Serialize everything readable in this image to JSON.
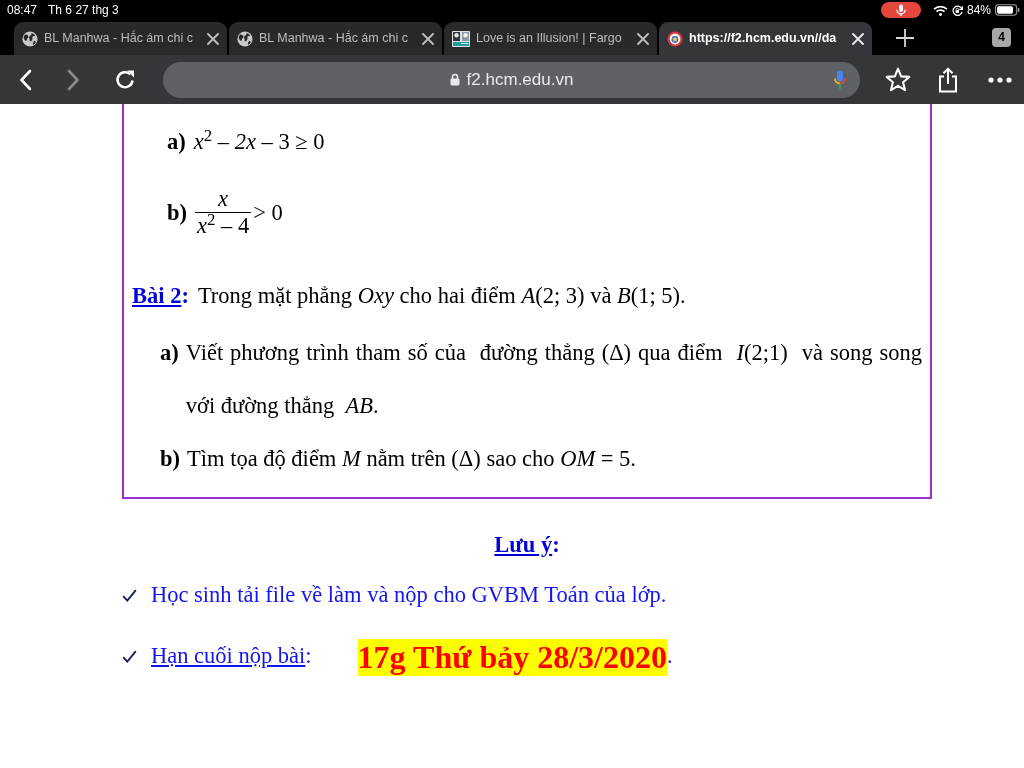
{
  "status_bar": {
    "time": "08:47",
    "date": "Th 6 27 thg 3",
    "battery": "84%"
  },
  "tabs": [
    {
      "title": "BL Manhwa - Hắc ám chi c",
      "kind": "generic",
      "selected": false
    },
    {
      "title": "BL Manhwa - Hắc ám chi c",
      "kind": "generic",
      "selected": false
    },
    {
      "title": "Love is an Illusion! | Fargo",
      "kind": "image",
      "selected": false
    },
    {
      "title": "https://f2.hcm.edu.vn//da",
      "kind": "logo",
      "selected": true
    }
  ],
  "tab_count": "4",
  "toolbar": {
    "back_disabled": false,
    "forward_disabled": true,
    "url": "f2.hcm.edu.vn"
  },
  "document": {
    "exercise_1_parts": [
      {
        "kind": "expression",
        "label": "a)",
        "expression": "*x*$^{2}$ – *2x* – 3 ≥ 0"
      },
      {
        "kind": "fraction",
        "label": "b)",
        "numerator": "*x*",
        "denominator": "*x*$^{2}$ – 4",
        "relation": "> 0"
      }
    ],
    "exercise_2": {
      "heading": "Bài 2",
      "heading_suffix": ":",
      "intro": "Trong mặt phẳng *Oxy* cho hai điểm *A*(2; 3) và *B*(1; 5).",
      "parts": [
        {
          "label": "a)",
          "text": "Viết phương trình tham số của  đường thẳng (Δ) qua điểm  *I*(2;1)  và song song với đường thẳng  *AB*."
        },
        {
          "label": "b)",
          "text": "Tìm tọa độ điểm *M* nằm trên (Δ) sao cho *OM* = 5."
        }
      ]
    },
    "notes": {
      "title": "Lưu ý",
      "title_suffix": ":",
      "items": [
        {
          "kind": "plain",
          "text": "Học sinh tải file về làm và nộp cho GVBM Toán của lớp."
        },
        {
          "kind": "deadline",
          "label": "Hạn cuối nộp bài",
          "label_suffix": ":",
          "deadline": "17g Thứ bảy 28/3/2020",
          "suffix": "."
        }
      ]
    }
  }
}
